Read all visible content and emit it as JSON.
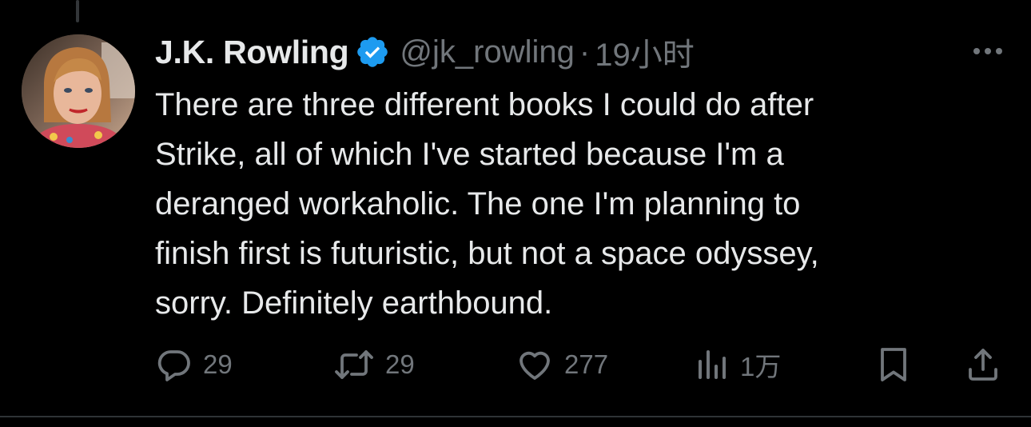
{
  "tweet": {
    "author": {
      "display_name": "J.K. Rowling",
      "handle": "@jk_rowling",
      "verified": true,
      "avatar_icon": "profile-photo"
    },
    "separator": "·",
    "timestamp": "19小时",
    "text": "There are three different books I could do after\nStrike, all of which I've started because I'm a\nderanged workaholic. The one I'm planning to\nfinish first is futuristic, but not a space odyssey,\nsorry. Definitely earthbound.",
    "stats": {
      "replies": "29",
      "reposts": "29",
      "likes": "277",
      "views": "1万"
    },
    "icons": {
      "reply": "reply-icon",
      "repost": "repost-icon",
      "like": "heart-icon",
      "views": "views-chart-icon",
      "bookmark": "bookmark-icon",
      "share": "share-icon",
      "more": "more-dots-icon",
      "verified": "verified-badge-icon"
    }
  },
  "colors": {
    "background": "#000000",
    "text_primary": "#e7e9ea",
    "text_secondary": "#71767b",
    "verified_blue": "#1d9bf0",
    "divider": "#2f3336"
  }
}
